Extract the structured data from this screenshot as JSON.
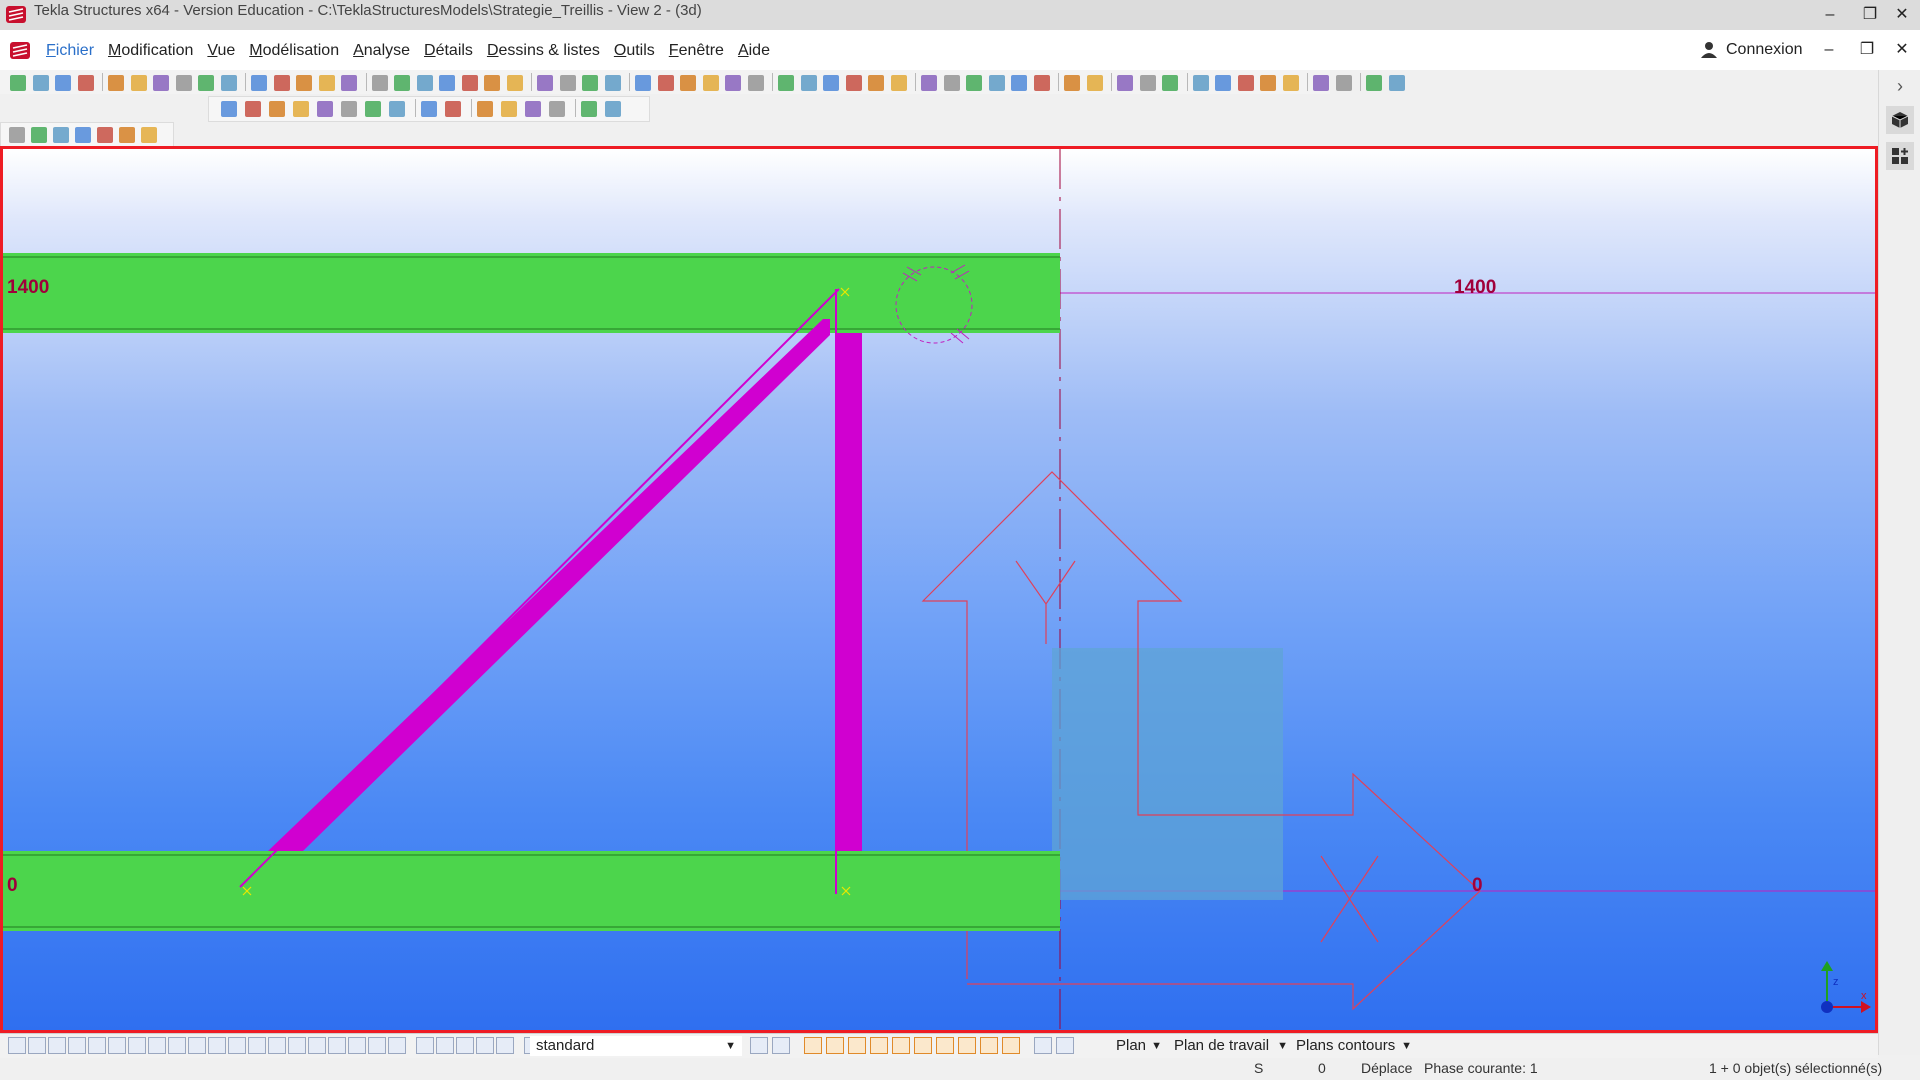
{
  "titlebar": {
    "title": "Tekla Structures x64 - Version Education - C:\\TeklaStructuresModels\\Strategie_Treillis  - View 2 - (3d)",
    "minimize": "–",
    "maximize": "❐",
    "close": "✕"
  },
  "menubar": {
    "items": [
      "Fichier",
      "Modification",
      "Vue",
      "Modélisation",
      "Analyse",
      "Détails",
      "Dessins & listes",
      "Outils",
      "Fenêtre",
      "Aide"
    ],
    "login_label": "Connexion"
  },
  "viewport": {
    "grid_label_top_left": "1400",
    "grid_label_top_right": "1400",
    "grid_label_bottom_left": "0",
    "grid_label_bottom_right": "0"
  },
  "colors": {
    "beam": "#4cd54c",
    "member": "#d000d0",
    "grid_line": "#c020c0",
    "label": "#a0003a",
    "frame": "#ee1c24",
    "workplane_arrows": "#e0405a",
    "workplane_box": "#5fa4d6"
  },
  "bottombar": {
    "filter_value": "standard",
    "plan_label": "Plan",
    "plan_travail_label": "Plan de travail",
    "plans_contours_label": "Plans contours"
  },
  "statusbar": {
    "s_label": "S",
    "s_value": "0",
    "deplace": "Déplace",
    "phase": "Phase courante: 1",
    "selection": "1 + 0 objet(s) sélectionné(s)"
  }
}
